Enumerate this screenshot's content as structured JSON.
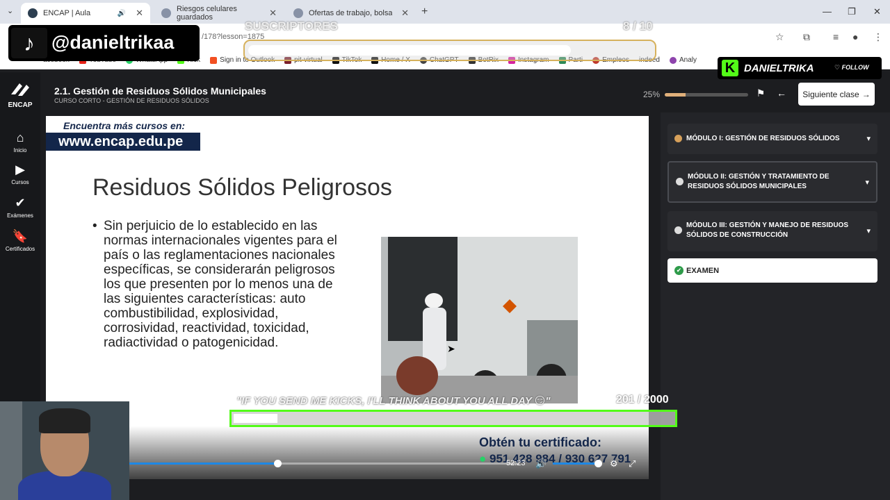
{
  "browser": {
    "tabs": [
      {
        "title": "ENCAP | Aula",
        "active": true
      },
      {
        "title": "Riesgos celulares guardados",
        "active": false
      },
      {
        "title": "Ofertas de trabajo, bolsa de tra",
        "active": false
      }
    ],
    "url": "/178?lesson=1875",
    "bookmarks": [
      "acebook",
      "YouTube",
      "WhatsApp",
      "Kick",
      "Sign in to Outlook",
      "pit-virtual",
      "TikTok",
      "Home / X",
      "ChatGPT",
      "BotRix",
      "Instagram",
      "Parti",
      "Empleos",
      "indeed",
      "Analy"
    ]
  },
  "app": {
    "logo": "ENCAP",
    "nav": [
      {
        "label": "Inicio",
        "icon": "home-icon"
      },
      {
        "label": "Cursos",
        "icon": "play-icon"
      },
      {
        "label": "Exámenes",
        "icon": "check-icon"
      },
      {
        "label": "Certificados",
        "icon": "bookmark-icon"
      }
    ],
    "lesson_title": "2.1. Gestión de Residuos Sólidos Municipales",
    "lesson_subtitle": "CURSO CORTO - GESTIÓN DE RESIDUOS SÓLIDOS",
    "progress_label": "25%",
    "progress": 0.25,
    "next_label": "Siguiente clase"
  },
  "video": {
    "promo_top": "Encuentra más cursos en:",
    "promo_url": "www.encap.edu.pe",
    "slide_title": "Residuos Sólidos Peligrosos",
    "bullet": "Sin perjuicio de lo establecido en las normas internacionales vigentes para el país o las reglamentaciones nacionales específicas, se considerarán peligrosos los que presenten por lo menos una de las siguientes características: auto combustibilidad, explosividad, corrosividad, reactividad, toxicidad, radiactividad o patogenicidad.",
    "cert_title": "Obtén tu certificado:",
    "phones": "951 428 984 / 930 627 791",
    "time": "52:23",
    "played": 0.38,
    "volume": 0.9
  },
  "modules": [
    {
      "label": "MÓDULO I: GESTIÓN DE RESIDUOS SÓLIDOS",
      "dot": "#d6a05a"
    },
    {
      "label": "MÓDULO II: GESTIÓN Y TRATAMIENTO DE RESIDUOS SÓLIDOS MUNICIPALES",
      "dot": "#dddddd"
    },
    {
      "label": "MÓDULO III: GESTIÓN Y MANEJO DE RESIDUOS SÓLIDOS DE CONSTRUCCIÓN",
      "dot": "#dddddd"
    }
  ],
  "exam_label": "EXAMEN",
  "overlay": {
    "tiktok_user": "@danieltrikaa",
    "subs_label": "SUSCRIPTORES",
    "subs_count": "8 / 10",
    "subs_progress": 0.8,
    "kick_name": "DANIELTRIKA",
    "kick_follow": "FOLLOW",
    "goal_text": "\"IF YOU SEND ME KICKS, I'LL THINK ABOUT YOU ALL DAY 😏\"",
    "goal_count": "201 / 2000",
    "goal_progress": 0.1
  }
}
